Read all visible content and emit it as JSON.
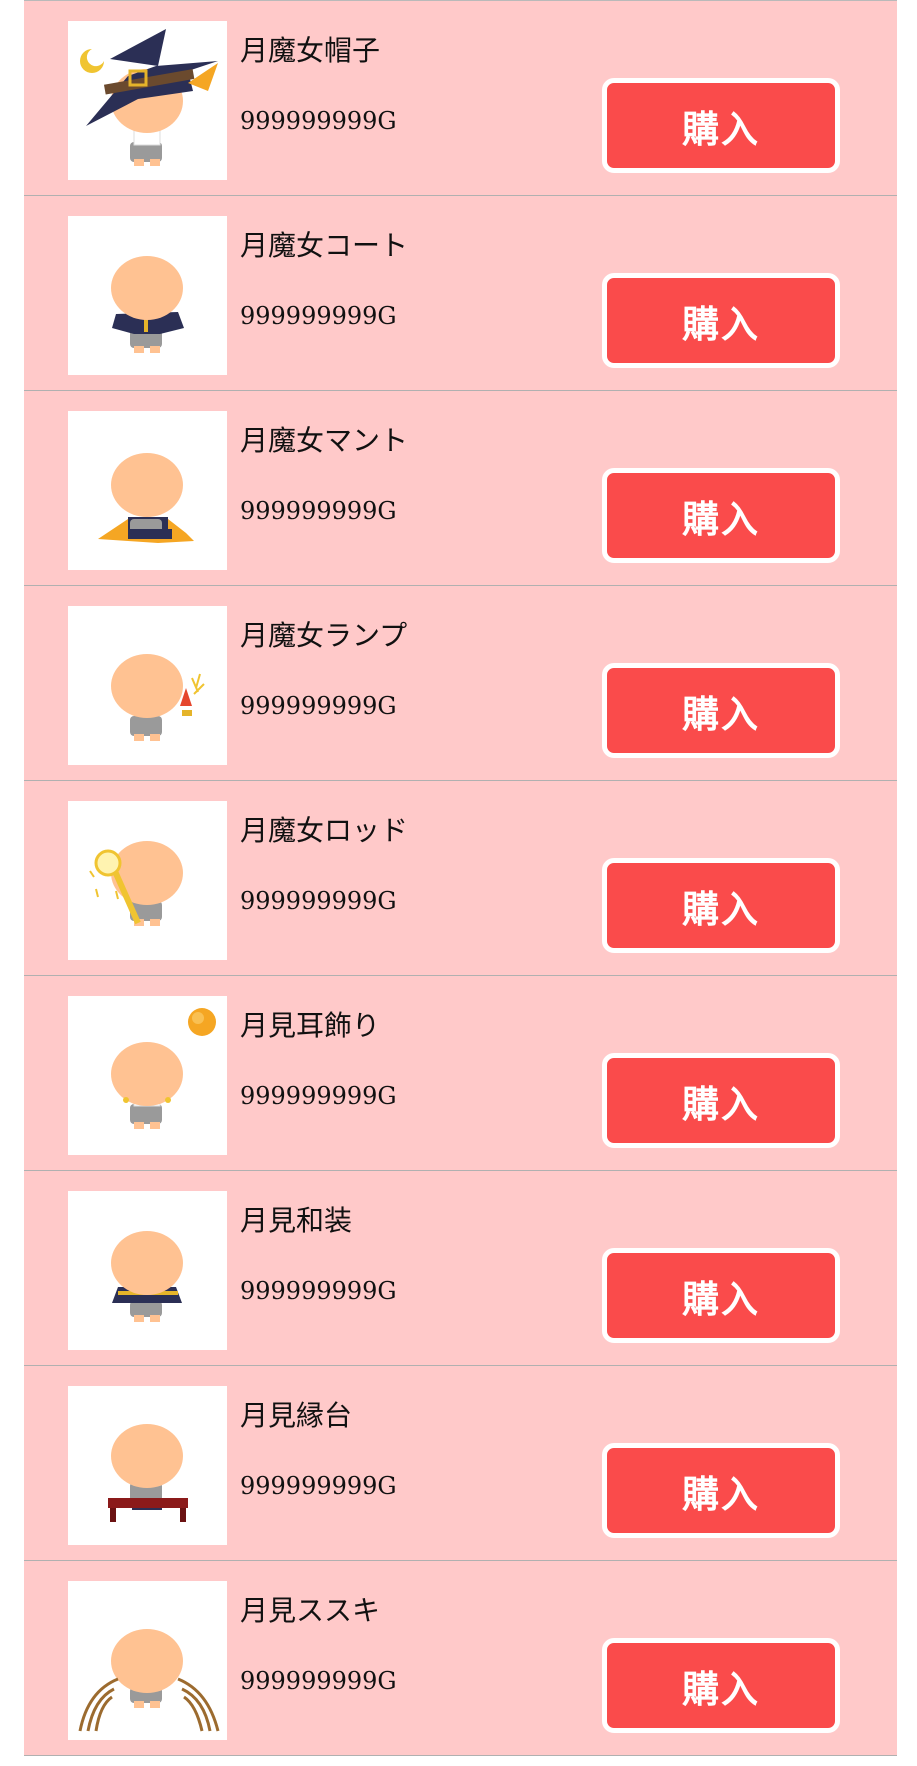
{
  "shop": {
    "buy_label": "購入",
    "items": [
      {
        "name": "月魔女帽子",
        "price": "999999999G",
        "icon": "witch-hat-icon"
      },
      {
        "name": "月魔女コート",
        "price": "999999999G",
        "icon": "witch-coat-icon"
      },
      {
        "name": "月魔女マント",
        "price": "999999999G",
        "icon": "witch-cape-icon"
      },
      {
        "name": "月魔女ランプ",
        "price": "999999999G",
        "icon": "witch-lamp-icon"
      },
      {
        "name": "月魔女ロッド",
        "price": "999999999G",
        "icon": "witch-rod-icon"
      },
      {
        "name": "月見耳飾り",
        "price": "999999999G",
        "icon": "moon-earring-icon"
      },
      {
        "name": "月見和装",
        "price": "999999999G",
        "icon": "moon-kimono-icon"
      },
      {
        "name": "月見縁台",
        "price": "999999999G",
        "icon": "moon-bench-icon"
      },
      {
        "name": "月見ススキ",
        "price": "999999999G",
        "icon": "pampas-grass-icon"
      }
    ]
  },
  "colors": {
    "row_background": "#ffc9c9",
    "buy_button": "#fa4b4b",
    "divider": "#b0b0b0",
    "skin": "#ffc292"
  }
}
